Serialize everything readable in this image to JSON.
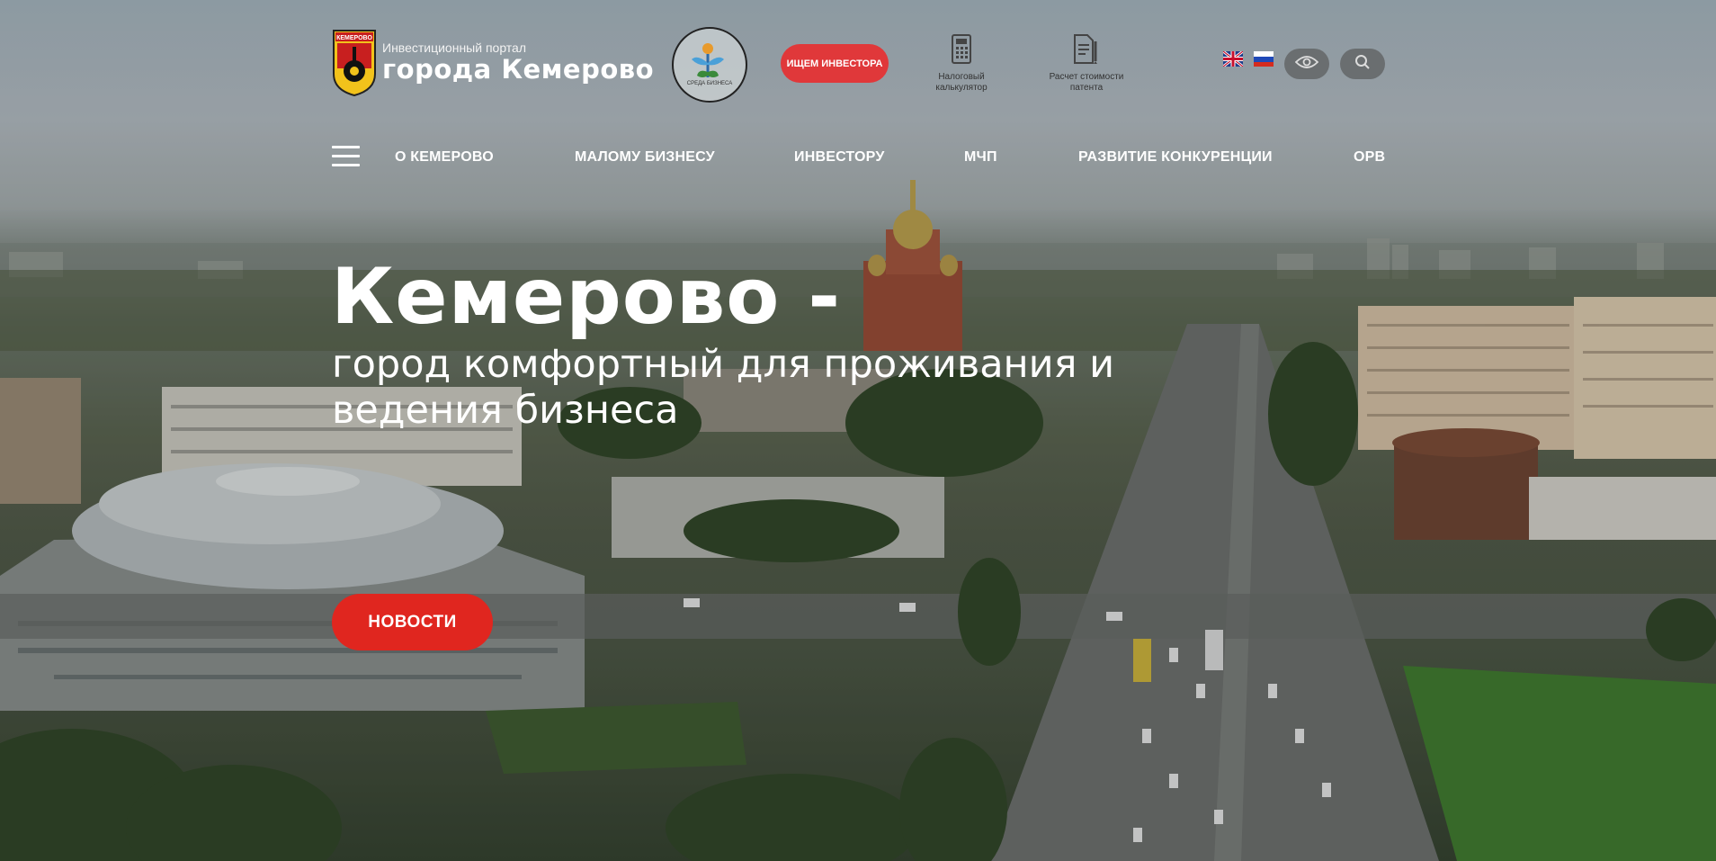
{
  "header": {
    "portal_subtitle": "Инвестиционный портал",
    "portal_title": "города Кемерово",
    "logo_text": "КЕМЕРОВО",
    "environment_badge": "СРЕДА БИЗНЕСА",
    "investor_button": "ИЩЕМ ИНВЕСТОРА",
    "tools": [
      {
        "label": "Налоговый калькулятор",
        "icon": "calculator-icon"
      },
      {
        "label": "Расчет стоимости патента",
        "icon": "document-icon"
      }
    ],
    "languages": [
      {
        "code": "en",
        "icon": "uk-flag-icon"
      },
      {
        "code": "ru",
        "icon": "russia-flag-icon"
      }
    ]
  },
  "nav": {
    "items": [
      "О КЕМЕРОВО",
      "МАЛОМУ БИЗНЕСУ",
      "ИНВЕСТОРУ",
      "МЧП",
      "РАЗВИТИЕ КОНКУРЕНЦИИ",
      "ОРВ"
    ]
  },
  "hero": {
    "title": "Кемерово -",
    "subtitle": "город комфортный для проживания и ведения бизнеса",
    "news_button": "НОВОСТИ"
  },
  "colors": {
    "accent_red": "#e0261f",
    "investor_pink": "#e0383a",
    "pill_gray": "#6a6e70"
  }
}
